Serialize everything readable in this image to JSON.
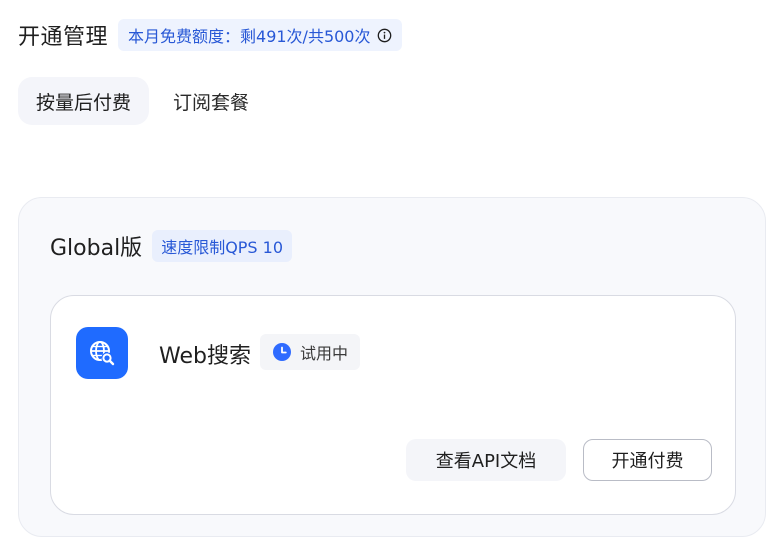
{
  "header": {
    "title": "开通管理",
    "quota": "本月免费额度：剩491次/共500次",
    "info_icon": "info-circle-icon"
  },
  "tabs": [
    {
      "label": "按量后付费",
      "active": true
    },
    {
      "label": "订阅套餐",
      "active": false
    }
  ],
  "plan": {
    "title": "Global版",
    "rate_limit": "速度限制QPS 10"
  },
  "service": {
    "icon": "globe-search-icon",
    "name": "Web搜索",
    "status_icon": "clock-icon",
    "status": "试用中",
    "docs_button": "查看API文档",
    "activate_button": "开通付费"
  },
  "colors": {
    "accent": "#1f6bff",
    "badge_text": "#2858d6",
    "badge_bg": "#eef3fe"
  }
}
